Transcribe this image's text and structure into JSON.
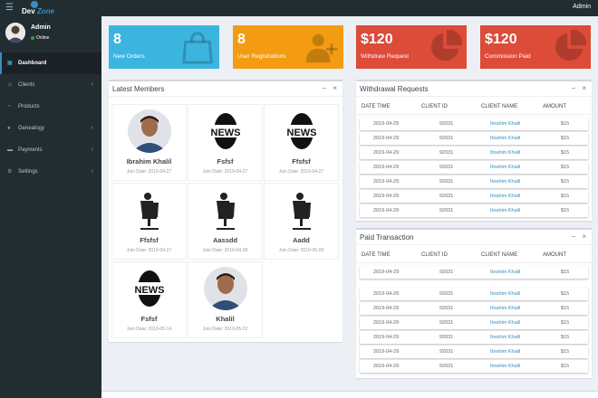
{
  "topbar": {
    "brand": "DevZone",
    "user": "Admin"
  },
  "user_panel": {
    "name": "Admin",
    "status": "Online"
  },
  "nav": [
    {
      "label": "Dashboard",
      "icon": "dashboard-icon",
      "active": true,
      "chevron": false
    },
    {
      "label": "Clients",
      "icon": "users-icon",
      "active": false,
      "chevron": true
    },
    {
      "label": "Products",
      "icon": "circle-notch-icon",
      "active": false,
      "chevron": false
    },
    {
      "label": "Genealogy",
      "icon": "tint-icon",
      "active": false,
      "chevron": true
    },
    {
      "label": "Payments",
      "icon": "money-icon",
      "active": false,
      "chevron": true
    },
    {
      "label": "Settings",
      "icon": "cogs-icon",
      "active": false,
      "chevron": true
    }
  ],
  "info_boxes": [
    {
      "value": "8",
      "label": "New Orders",
      "color": "#3cb4e0",
      "icon": "shopping-bag-icon"
    },
    {
      "value": "8",
      "label": "User Registrations",
      "color": "#f39c12",
      "icon": "user-plus-icon"
    },
    {
      "value": "$120",
      "label": "Withdraw Request",
      "color": "#dd4b39",
      "icon": "pie-chart-icon"
    },
    {
      "value": "$120",
      "label": "Commission Paid",
      "color": "#dd4b39",
      "icon": "pie-chart-icon"
    }
  ],
  "members_panel": {
    "title": "Latest Members",
    "members": [
      {
        "name": "Ibrahim Khalil",
        "date": "Join Date: 2019-04-27",
        "img": "person-photo"
      },
      {
        "name": "Fsfsf",
        "date": "Join Date: 2019-04-27",
        "img": "news-logo"
      },
      {
        "name": "Ffsfsf",
        "date": "Join Date: 2019-04-27",
        "img": "news-logo"
      },
      {
        "name": "Ffsfsf",
        "date": "Join Date: 2019-04-27",
        "img": "chair-silhouette"
      },
      {
        "name": "Aassdd",
        "date": "Join Date: 2019-04-28",
        "img": "chair-silhouette"
      },
      {
        "name": "Aadd",
        "date": "Join Date: 2019-05-09",
        "img": "chair-silhouette"
      },
      {
        "name": "Fsfsf",
        "date": "Join Date: 2019-05-14",
        "img": "news-logo"
      },
      {
        "name": "Khalil",
        "date": "Join Date: 2019-05-22",
        "img": "person-photo"
      }
    ],
    "news_text": "NEWS"
  },
  "withdrawal": {
    "title": "Withdrawal Requests",
    "headers": [
      "DATE TIME",
      "CLIENT ID",
      "CLIENT NAME",
      "AMOUNT"
    ],
    "rows": [
      [
        "2019-04-29",
        "92031",
        "Ibrahim Khalil",
        "$15"
      ],
      [
        "2019-04-29",
        "92031",
        "Ibrahim Khalil",
        "$15"
      ],
      [
        "2019-04-29",
        "92031",
        "Ibrahim Khalil",
        "$15"
      ],
      [
        "2019-04-29",
        "92031",
        "Ibrahim Khalil",
        "$15"
      ],
      [
        "2019-04-29",
        "92031",
        "Ibrahim Khalil",
        "$15"
      ],
      [
        "2019-04-29",
        "92031",
        "Ibrahim Khalil",
        "$15"
      ],
      [
        "2019-04-29",
        "92031",
        "Ibrahim Khalil",
        "$15"
      ]
    ]
  },
  "paid": {
    "title": "Paid Transaction",
    "headers": [
      "DATE TIME",
      "CLIENT ID",
      "CLIENT NAME",
      "AMOUNT"
    ],
    "rows": [
      [
        "2019-04-29",
        "92031",
        "Ibrahim Khalil",
        "$15"
      ],
      [
        "2019-04-29",
        "92031",
        "Ibrahim Khalil",
        "$15"
      ],
      [
        "2019-04-29",
        "92031",
        "Ibrahim Khalil",
        "$15"
      ],
      [
        "2019-04-29",
        "92031",
        "Ibrahim Khalil",
        "$15"
      ],
      [
        "2019-04-29",
        "92031",
        "Ibrahim Khalil",
        "$15"
      ],
      [
        "2019-04-29",
        "92031",
        "Ibrahim Khalil",
        "$15"
      ],
      [
        "2019-04-29",
        "92031",
        "Ibrahim Khalil",
        "$15"
      ]
    ]
  },
  "colors": {
    "sidebar": "#222d32",
    "accent": "#3c8dbc",
    "link": "#3c8dbc"
  }
}
